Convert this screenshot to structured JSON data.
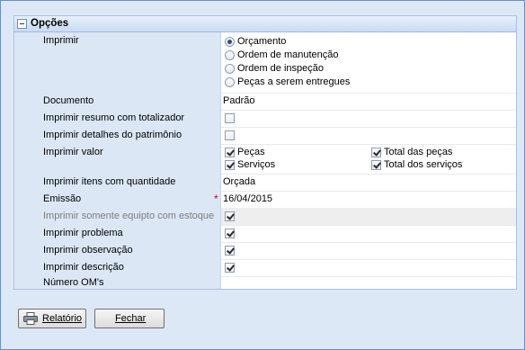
{
  "group": {
    "title": "Opções"
  },
  "rows": {
    "imprimir": {
      "label": "Imprimir",
      "options": [
        "Orçamento",
        "Ordem de manutenção",
        "Ordem de inspeção",
        "Peças a serem entregues"
      ],
      "selected": "Orçamento"
    },
    "documento": {
      "label": "Documento",
      "value": "Padrão"
    },
    "resumo": {
      "label": "Imprimir resumo com totalizador",
      "checked": false
    },
    "detalhes": {
      "label": "Imprimir detalhes do patrimônio",
      "checked": false
    },
    "valor": {
      "label": "Imprimir valor",
      "options": [
        {
          "label": "Peças",
          "checked": true
        },
        {
          "label": "Total das peças",
          "checked": true
        },
        {
          "label": "Serviços",
          "checked": true
        },
        {
          "label": "Total dos serviços",
          "checked": true
        }
      ]
    },
    "itens": {
      "label": "Imprimir itens com quantidade",
      "value": "Orçada"
    },
    "emissao": {
      "label": "Emissão",
      "value": "16/04/2015",
      "required_mark": "*"
    },
    "estoque": {
      "label": "Imprimir somente equipto com estoque",
      "checked": true,
      "disabled": true
    },
    "problema": {
      "label": "Imprimir problema",
      "checked": true
    },
    "observacao": {
      "label": "Imprimir observação",
      "checked": true
    },
    "descricao": {
      "label": "Imprimir descrição",
      "checked": true
    },
    "numero_om": {
      "label": "Número OM's",
      "value": ""
    }
  },
  "buttons": {
    "relatorio": "Relatório",
    "fechar": "Fechar"
  },
  "colors": {
    "label_bg": "#dce7f6",
    "window_bg": "#dde8f7",
    "border": "#6b8fc2",
    "required": "#dd0000"
  }
}
